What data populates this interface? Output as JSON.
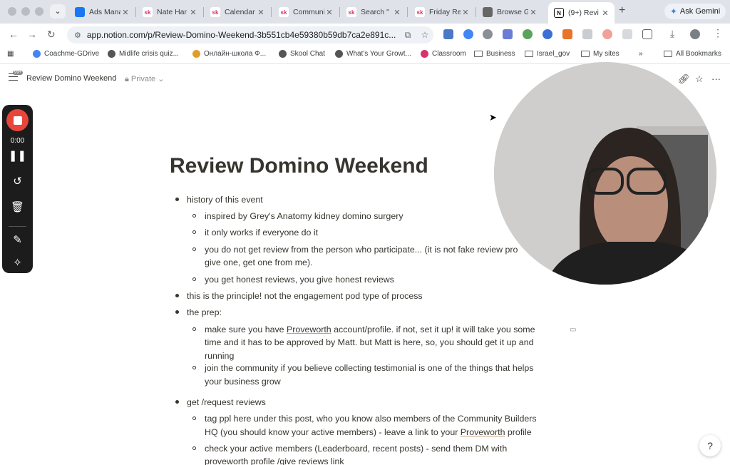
{
  "browser": {
    "tabs": [
      {
        "label": "Ads Mana",
        "fav_text": "",
        "fav_color": "#1877f2"
      },
      {
        "label": "Nate Har",
        "fav_text": "sk",
        "fav_color": "#ffffff"
      },
      {
        "label": "Calendar",
        "fav_text": "sk",
        "fav_color": "#ffffff"
      },
      {
        "label": "Communi",
        "fav_text": "sk",
        "fav_color": "#ffffff"
      },
      {
        "label": "Search \"",
        "fav_text": "sk",
        "fav_color": "#ffffff"
      },
      {
        "label": "Friday Re",
        "fav_text": "sk",
        "fav_color": "#ffffff"
      },
      {
        "label": "Browse G",
        "fav_text": "",
        "fav_color": "#666666"
      },
      {
        "label": "(9+) Revi",
        "fav_text": "N",
        "fav_color": "#ffffff"
      }
    ],
    "ask_gemini": "Ask Gemini",
    "url": "app.notion.com/p/Review-Domino-Weekend-3b551cb4e59380b59db7ca2e891c...",
    "bookmarks": [
      {
        "label": "Coachme-GDrive",
        "type": "site"
      },
      {
        "label": "Midlife crisis quiz...",
        "type": "site"
      },
      {
        "label": "Онлайн-школа Ф...",
        "type": "site"
      },
      {
        "label": "Skool Chat",
        "type": "site"
      },
      {
        "label": "What's Your Growt...",
        "type": "site"
      },
      {
        "label": "Classroom",
        "type": "site"
      },
      {
        "label": "Business",
        "type": "folder"
      },
      {
        "label": "Israel_gov",
        "type": "folder"
      },
      {
        "label": "My sites",
        "type": "folder"
      },
      {
        "label": "All Bookmarks",
        "type": "folder"
      }
    ],
    "more_bookmarks": "»"
  },
  "notion": {
    "badge": "99+",
    "page_title": "Review Domino Weekend",
    "privacy": "Private",
    "privacy_caret": "⌄"
  },
  "recorder": {
    "timer": "0:00"
  },
  "document": {
    "title": "Review Domino Weekend",
    "lines": [
      {
        "level": 1,
        "text": "history of this event"
      },
      {
        "level": 2,
        "text": "inspired by Grey's Anatomy kidney domino surgery"
      },
      {
        "level": 2,
        "text": "it only works if everyone do it"
      },
      {
        "level": 2,
        "text": "you do not get review from the person who participate... (it is not fake review pro"
      },
      {
        "level": 0,
        "text": "give one, get one from me)."
      },
      {
        "level": 2,
        "text": "you get honest reviews, you give honest reviews"
      },
      {
        "level": 1,
        "text": "this is the principle! not the engagement pod type of process"
      },
      {
        "level": 1,
        "text": "the prep:"
      },
      {
        "level": 2,
        "pre": "make sure you have ",
        "link": "Proveworth",
        "post": " account/profile. if not, set it up!  it will take you some"
      },
      {
        "level": 0,
        "text": "time and it has to be approved by Matt. but Matt is here, so, you should get it up and"
      },
      {
        "level": 0,
        "text": "running"
      },
      {
        "level": 2,
        "text": "join the community if you believe collecting testimonial is one of the things that helps"
      },
      {
        "level": 0,
        "text": "your business grow"
      },
      {
        "level": 1,
        "text": "get /request reviews"
      },
      {
        "level": 2,
        "text": "tag ppl here under this post, who you know also members of the Community Builders"
      },
      {
        "level": 0,
        "pre": "HQ (you should know your active members) - leave a link to your ",
        "link": "Proveworth",
        "post": " profile"
      },
      {
        "level": 2,
        "text": "check your active members (Leaderboard, recent posts) - send them DM with"
      },
      {
        "level": 0,
        "text": "proveworth profile /give reviews link"
      }
    ]
  },
  "colors": {
    "record_red": "#e8463a",
    "recorder_bg": "#1c1c1c",
    "text": "#37352f"
  },
  "icons": {
    "help": "?"
  }
}
